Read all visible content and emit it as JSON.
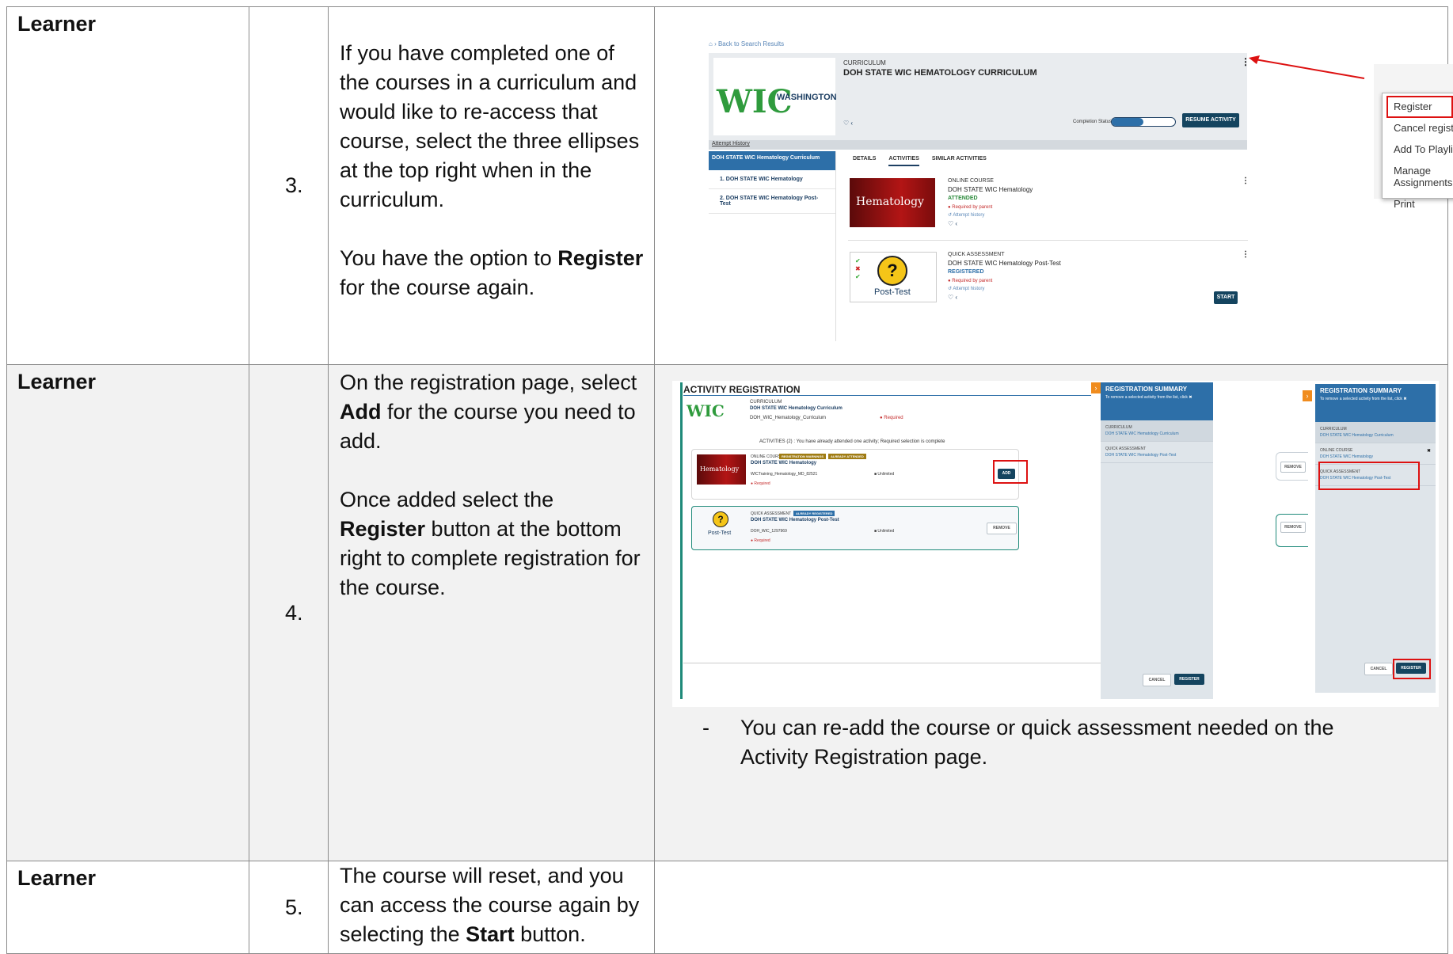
{
  "rows": [
    {
      "role": "Learner",
      "step": "3.",
      "para1": "If you have completed one of the courses in a curriculum and would like to re-access that course, select the three ellipses at the top right when in the curriculum.",
      "para2_pre": "You have the option to ",
      "para2_bold": "Register",
      "para2_post": " for the course again."
    },
    {
      "role": "Learner",
      "step": "4.",
      "para1_pre": "On the registration page, select ",
      "para1_bold": "Add",
      "para1_post": " for the course you need to add.",
      "para2_pre": "Once added select the ",
      "para2_bold": "Register",
      "para2_post": " button at the bottom right to complete registration for the course.",
      "note_dash": "-",
      "note": "You can re-add the course or quick assessment needed on the Activity Registration page."
    },
    {
      "role": "Learner",
      "step": "5.",
      "para1_pre": "The course will reset, and you can access the course again by selecting the ",
      "para1_bold": "Start",
      "para1_post": " button."
    }
  ],
  "shot1": {
    "breadcrumb": "Back to Search Results",
    "logo_main": "WIC",
    "logo_sub": "WASHINGTON",
    "type": "CURRICULUM",
    "title": "DOH STATE WIC HEMATOLOGY CURRICULUM",
    "completion_label": "Completion Status",
    "completion_pct": "50%",
    "completion_fraction": 0.5,
    "resume_btn": "RESUME ACTIVITY",
    "attempt_history": "Attempt History",
    "sidebar": [
      "DOH STATE WIC Hematology Curriculum",
      "1. DOH STATE WIC Hematology",
      "2. DOH STATE WIC Hematology Post-Test"
    ],
    "tabs": [
      "DETAILS",
      "ACTIVITIES",
      "SIMILAR ACTIVITIES"
    ],
    "item1": {
      "thumb": "Hematology",
      "type": "ONLINE COURSE",
      "title": "DOH STATE WIC Hematology",
      "status": "ATTENDED",
      "req": "Required by parent",
      "hist": "Attempt history"
    },
    "item2": {
      "thumb": "Post-Test",
      "type": "QUICK ASSESSMENT",
      "title": "DOH STATE WIC Hematology Post-Test",
      "status": "REGISTERED",
      "req": "Required by parent",
      "hist": "Attempt history",
      "start": "START"
    },
    "menu": [
      "Register",
      "Cancel registration",
      "Add To Playlist",
      "Manage Assignments",
      "Print"
    ]
  },
  "shot2": {
    "heading": "ACTIVITY REGISTRATION",
    "type": "CURRICULUM",
    "title": "DOH STATE WIC Hematology Curriculum",
    "code": "DOH_WIC_Hematology_Curriculum",
    "required": "Required",
    "activities_line": "ACTIVITIES (2) : You have already attended one activity; Required selection is complete",
    "c1": {
      "type": "ONLINE COURSE",
      "badge1": "REGISTRATION WARNINGS",
      "badge2": "ALREADY ATTENDED",
      "title": "DOH STATE WIC Hematology",
      "code": "WICTraining_Hematology_MD_82521",
      "seats": "Unlimited",
      "req": "Required",
      "btn": "ADD",
      "thumb": "Hematology"
    },
    "c2": {
      "type": "QUICK ASSESSMENT",
      "badge": "ALREADY REGISTERED",
      "title": "DOH STATE WIC Hematology Post-Test",
      "code": "DOH_WIC_1297969",
      "seats": "Unlimited",
      "req": "Required",
      "btn": "REMOVE",
      "thumb": "Post-Test"
    },
    "summary_title": "REGISTRATION SUMMARY",
    "summary_sub": "To remove a selected activity from the list, click",
    "sum_items": [
      {
        "type": "CURRICULUM",
        "name": "DOH STATE WIC Hematology Curriculum"
      },
      {
        "type": "QUICK ASSESSMENT",
        "name": "DOH STATE WIC Hematology Post-Test"
      }
    ],
    "cancel": "CANCEL",
    "register": "REGISTER"
  },
  "shot3": {
    "summary_title": "REGISTRATION SUMMARY",
    "summary_sub": "To remove a selected activity from the list, click",
    "sum_items": [
      {
        "type": "CURRICULUM",
        "name": "DOH STATE WIC Hematology Curriculum"
      },
      {
        "type": "ONLINE COURSE",
        "name": "DOH STATE WIC Hematology"
      },
      {
        "type": "QUICK ASSESSMENT",
        "name": "DOH STATE WIC Hematology Post-Test"
      }
    ],
    "remove": "REMOVE",
    "cancel": "CANCEL",
    "register": "REGISTER"
  }
}
